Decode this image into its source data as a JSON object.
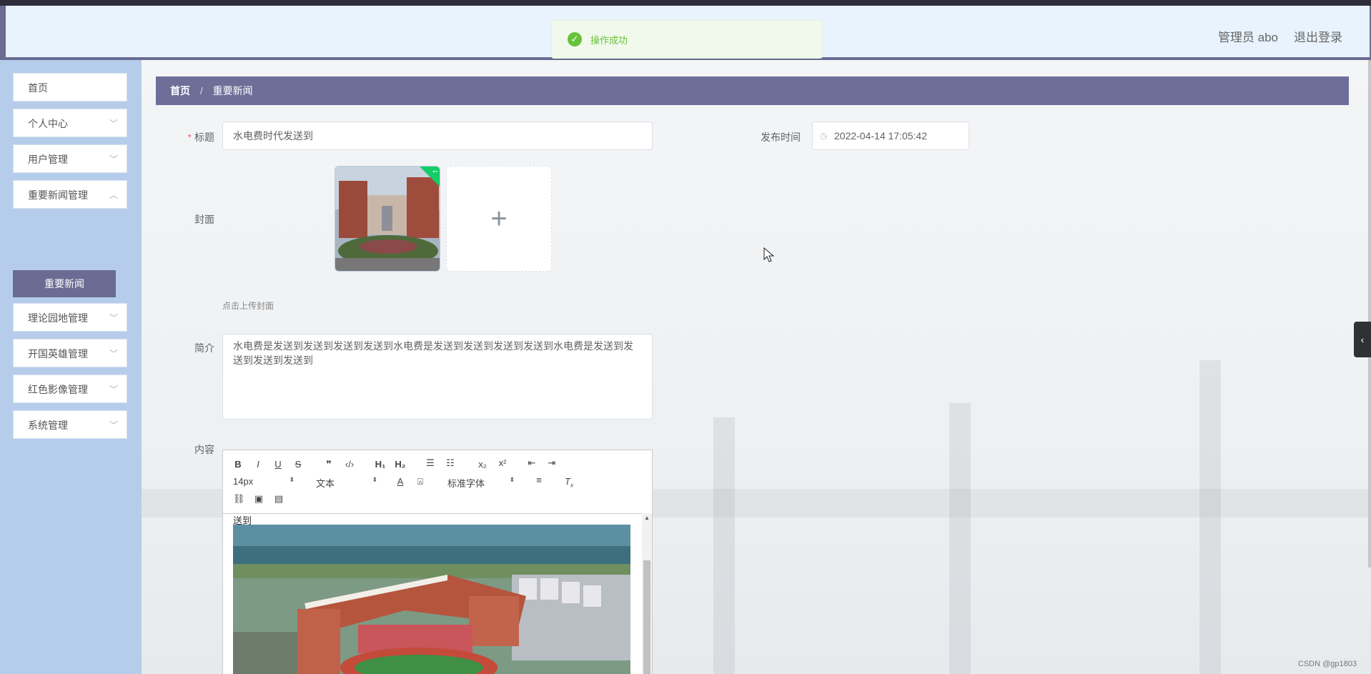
{
  "header": {
    "user_text": "管理员 abo",
    "logout_label": "退出登录"
  },
  "toast": {
    "message": "操作成功",
    "icon": "check-circle-icon"
  },
  "sidebar": {
    "items": [
      {
        "label": "首页",
        "has_chevron": false
      },
      {
        "label": "个人中心",
        "has_chevron": true
      },
      {
        "label": "用户管理",
        "has_chevron": true
      },
      {
        "label": "重要新闻管理",
        "has_chevron": true
      },
      {
        "label": "理论园地管理",
        "has_chevron": true
      },
      {
        "label": "开国英雄管理",
        "has_chevron": true
      },
      {
        "label": "红色影像管理",
        "has_chevron": true
      },
      {
        "label": "系统管理",
        "has_chevron": true
      }
    ],
    "active_sub": "重要新闻"
  },
  "breadcrumb": {
    "home": "首页",
    "separator": "/",
    "current": "重要新闻"
  },
  "form": {
    "title_label": "标题",
    "title_value": "水电费时代发送到",
    "publish_label": "发布时间",
    "publish_value": "2022-04-14 17:05:42",
    "cover_label": "封面",
    "cover_hint": "点击上传封面",
    "summary_label": "简介",
    "summary_value": "水电费是发送到发送到发送到发送到水电费是发送到发送到发送到发送到水电费是发送到发送到发送到发送到",
    "content_label": "内容"
  },
  "editor": {
    "font_size": "14px",
    "header_select": "文本",
    "font_family": "标准字体",
    "body_text": "送到"
  },
  "footer": {
    "watermark": "CSDN @gp1803"
  },
  "colors": {
    "header_bg": "#e8f3fd",
    "sidebar_bg": "#b5cdea",
    "accent": "#6e6e99",
    "success": "#67c23a"
  }
}
